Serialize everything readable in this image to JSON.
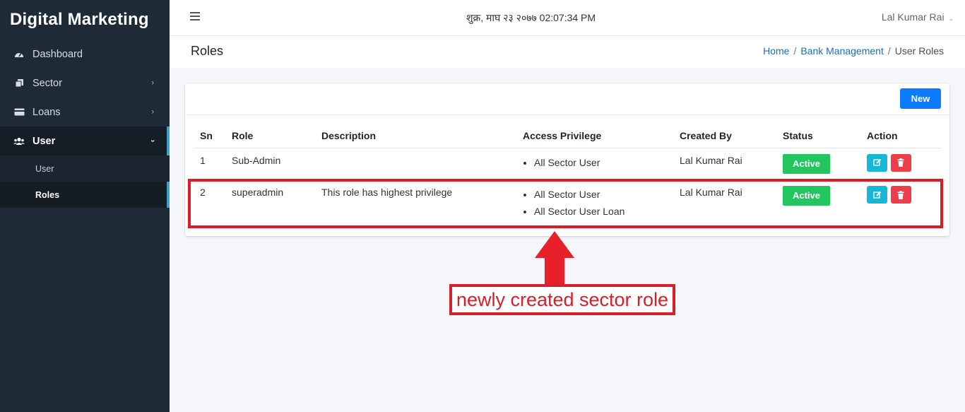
{
  "app": {
    "title": "Digital Marketing"
  },
  "sidebar": {
    "items": [
      {
        "label": "Dashboard",
        "icon": "dashboard-icon"
      },
      {
        "label": "Sector",
        "icon": "copy-icon",
        "has_children": true
      },
      {
        "label": "Loans",
        "icon": "card-icon",
        "has_children": true
      },
      {
        "label": "User",
        "icon": "users-icon",
        "has_children": true,
        "expanded": true
      }
    ],
    "subitems": [
      {
        "label": "User"
      },
      {
        "label": "Roles",
        "current": true
      }
    ]
  },
  "topbar": {
    "datetime": "शुक्र, माघ २३ २०७७ 02:07:34 PM",
    "user_name": "Lal Kumar Rai"
  },
  "page": {
    "title": "Roles",
    "breadcrumb": [
      "Home",
      "Bank Management",
      "User Roles"
    ]
  },
  "toolbar": {
    "new_label": "New"
  },
  "table": {
    "headers": [
      "Sn",
      "Role",
      "Description",
      "Access Privilege",
      "Created By",
      "Status",
      "Action"
    ],
    "rows": [
      {
        "sn": "1",
        "role": "Sub-Admin",
        "description": "",
        "privileges": [
          "All Sector User"
        ],
        "created_by": "Lal Kumar Rai",
        "status": "Active"
      },
      {
        "sn": "2",
        "role": "superadmin",
        "description": "This role has highest privilege",
        "privileges": [
          "All Sector User",
          "All Sector User Loan"
        ],
        "created_by": "Lal Kumar Rai",
        "status": "Active"
      }
    ]
  },
  "annotation": {
    "text": "newly created sector role"
  },
  "colors": {
    "sidebar_bg": "#1e2a35",
    "accent_blue": "#0b7bff",
    "active_green": "#22c55e",
    "edit_cyan": "#17b8d6",
    "delete_red": "#ec3d4a",
    "annotation_red": "#d71f2a",
    "active_indicator": "#3ea2c8"
  }
}
